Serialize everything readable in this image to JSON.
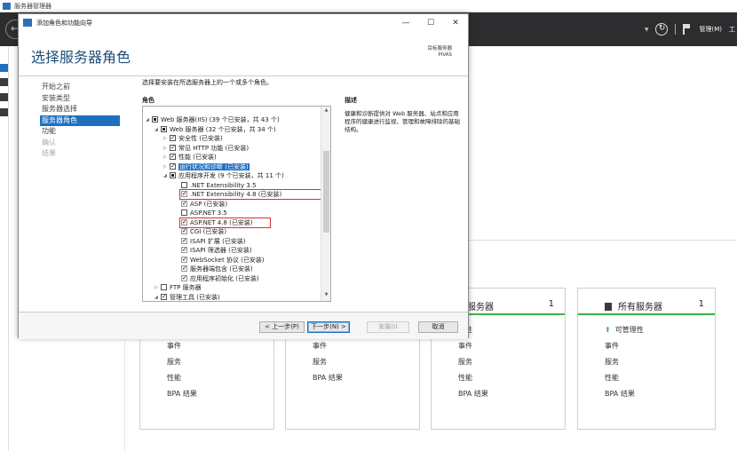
{
  "server_manager": {
    "title": "服务器管理器",
    "menu_manage": "管理(M)",
    "menu_tools": "工",
    "tiles": [
      {
        "name": "",
        "count": "",
        "rows": [
          "事件",
          "服务",
          "性能",
          "BPA 结果"
        ]
      },
      {
        "name": "",
        "count": "",
        "rows": [
          "事件",
          "服务",
          "BPA 结果"
        ]
      },
      {
        "name": "地服务器",
        "count": "1",
        "first_row": "理性",
        "rows": [
          "事件",
          "服务",
          "性能",
          "BPA 结果"
        ]
      },
      {
        "name": "所有服务器",
        "count": "1",
        "first_row": "可管理性",
        "rows": [
          "事件",
          "服务",
          "性能",
          "BPA 结果"
        ]
      }
    ]
  },
  "wizard": {
    "title": "添加角色和功能向导",
    "heading": "选择服务器角色",
    "dest_label": "目标服务器",
    "dest_server": "PIVAS",
    "nav": [
      "开始之前",
      "安装类型",
      "服务器选择",
      "服务器角色",
      "功能",
      "确认",
      "结果"
    ],
    "intro": "选择要安装在所选服务器上的一个或多个角色。",
    "roles_label": "角色",
    "desc_label": "描述",
    "description": "健康和诊断提供对 Web 服务器、站点和应用程序的健康进行监视、管理和故障排除的基础结构。",
    "tree": [
      "Web 服务器(IIS) (39 个已安装，共 43 个)",
      "Web 服务器 (32 个已安装，共 34 个)",
      "安全性 (已安装)",
      "常见 HTTP 功能 (已安装)",
      "性能 (已安装)",
      "运行状况和诊断 (已安装)",
      "应用程序开发 (9 个已安装，共 11 个)",
      ".NET Extensibility 3.5",
      ".NET Extensibility 4.8 (已安装)",
      "ASP (已安装)",
      "ASP.NET 3.5",
      "ASP.NET 4.8 (已安装)",
      "CGI (已安装)",
      "ISAPI 扩展 (已安装)",
      "ISAPI 筛选器 (已安装)",
      "WebSocket 协议 (已安装)",
      "服务器端包含 (已安装)",
      "应用程序初始化 (已安装)",
      "FTP 服务器",
      "管理工具 (已安装)"
    ],
    "buttons": {
      "prev": "< 上一步(P)",
      "next": "下一步(N) >",
      "install": "安装(I)",
      "cancel": "取消"
    }
  }
}
